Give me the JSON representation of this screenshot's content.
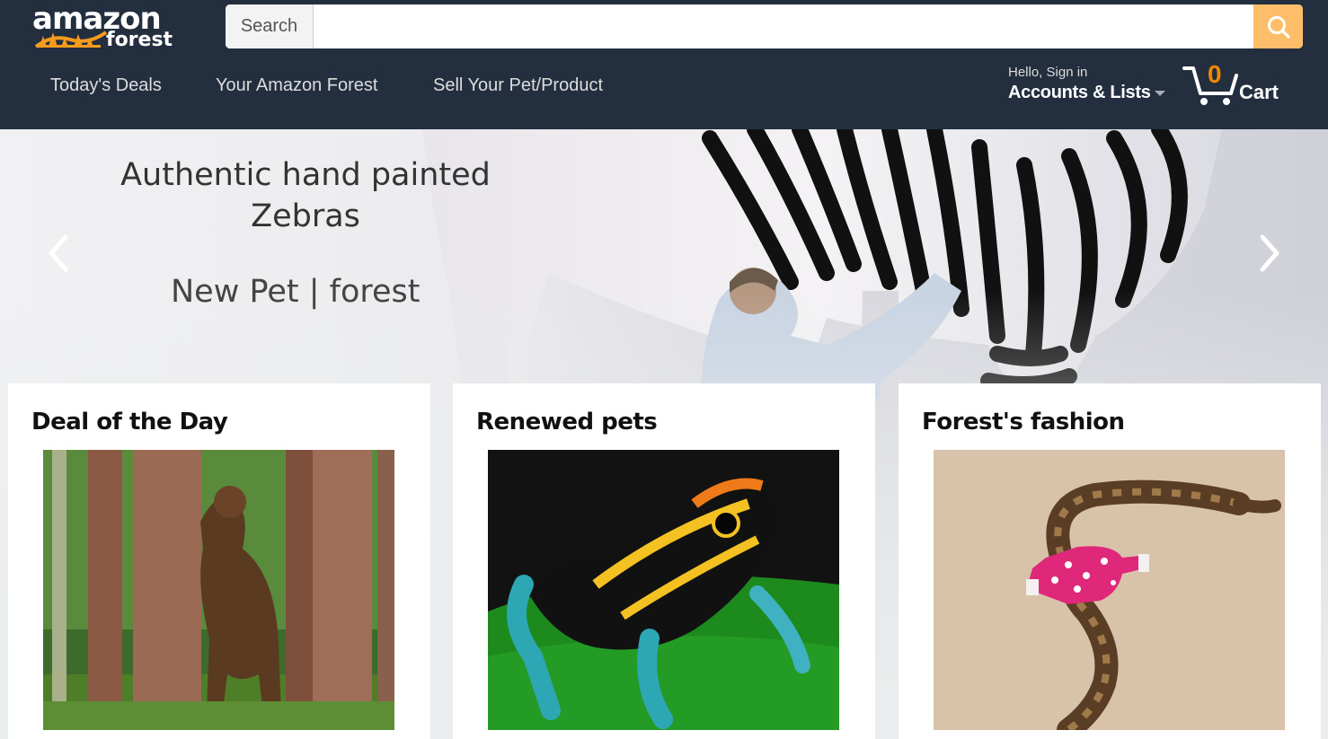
{
  "header": {
    "logo_main": "amazon",
    "logo_sub": "forest",
    "search": {
      "department_label": "Search",
      "value": "",
      "placeholder": ""
    },
    "nav_links": [
      "Today's Deals",
      "Your Amazon Forest",
      "Sell Your Pet/Product"
    ],
    "account": {
      "greeting": "Hello, Sign in",
      "label": "Accounts & Lists"
    },
    "cart": {
      "count": "0",
      "label": "Cart"
    }
  },
  "hero": {
    "title": "Authentic hand painted Zebras",
    "subtitle": "New Pet | forest"
  },
  "cards": [
    {
      "title": "Deal of the Day"
    },
    {
      "title": "Renewed pets"
    },
    {
      "title": "Forest's fashion"
    }
  ],
  "colors": {
    "header_bg": "#232f3e",
    "search_button": "#febd69",
    "cart_count": "#f08804",
    "page_bg": "#eaeded"
  }
}
